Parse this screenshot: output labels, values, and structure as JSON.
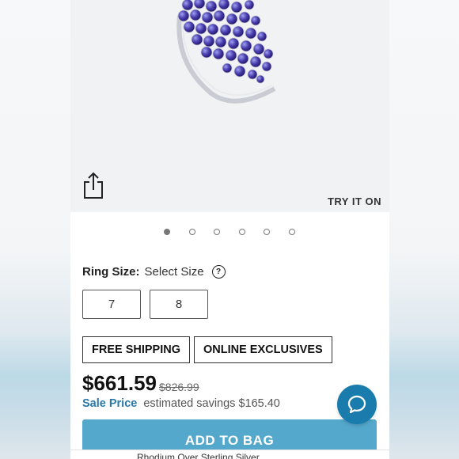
{
  "hero": {
    "try_on_label": "TRY IT ON",
    "share_icon": "share-icon",
    "slide_count": 6,
    "active_slide": 1
  },
  "ring_size": {
    "label": "Ring Size:",
    "value": "Select Size",
    "help_icon": "question-icon",
    "options": [
      "7",
      "8"
    ]
  },
  "badges": [
    "FREE SHIPPING",
    "ONLINE EXCLUSIVES"
  ],
  "pricing": {
    "price": "$661.59",
    "original_price": "$826.99",
    "sale_label": "Sale Price",
    "savings_text": "estimated savings $165.40"
  },
  "add_to_bag_label": "ADD TO BAG",
  "bottom_text": "Rhodium Over Sterling Silver",
  "colors": {
    "accent_blue": "#53a8cc",
    "sale_blue": "#2877a9",
    "chat_blue": "#1a7cad",
    "gem": "#4b3fb0"
  },
  "chat_icon": "chat-bubble-icon"
}
